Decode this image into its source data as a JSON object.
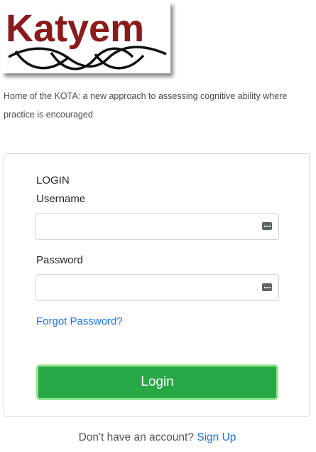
{
  "logo": {
    "text": "Katyem",
    "text_color": "#8b1a1a"
  },
  "tagline": "Home of the KOTA: a new approach to assessing cognitive ability where practice is encouraged",
  "login_card": {
    "heading": "LOGIN",
    "username_label": "Username",
    "username_value": "",
    "password_label": "Password",
    "password_value": "",
    "forgot_password": "Forgot Password?",
    "login_button": "Login"
  },
  "signup": {
    "prompt": "Don't have an account?",
    "link": "Sign Up"
  },
  "colors": {
    "accent_link": "#1a73e8",
    "button_green": "#28a745",
    "button_border": "#8fe58f"
  },
  "icons": {
    "username_field": "password-manager-icon",
    "password_field": "password-manager-icon"
  }
}
